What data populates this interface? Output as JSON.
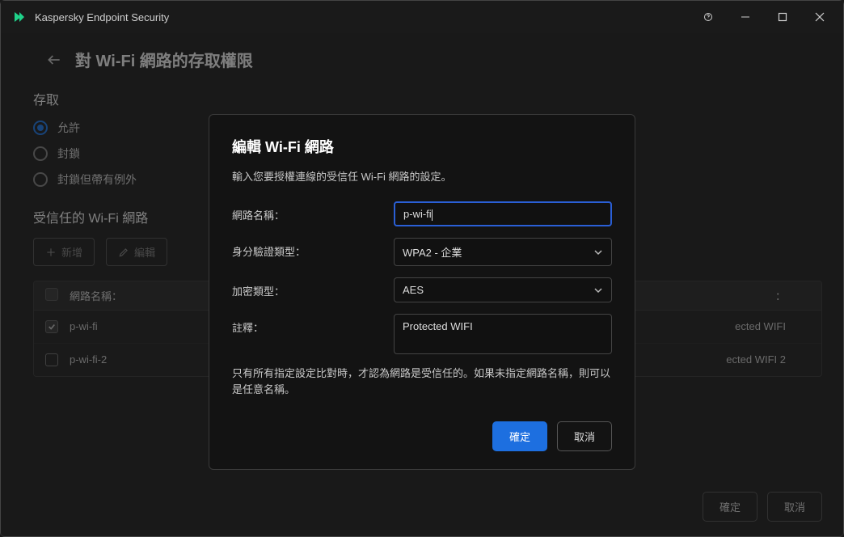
{
  "titlebar": {
    "app_title": "Kaspersky Endpoint Security"
  },
  "page": {
    "title": "對 Wi-Fi 網路的存取權限"
  },
  "access": {
    "section_label": "存取",
    "options": {
      "allow": "允許",
      "block": "封鎖",
      "block_with_exceptions": "封鎖但帶有例外"
    },
    "selected": "allow"
  },
  "trusted": {
    "label": "受信任的 Wi-Fi 網路",
    "add_label": "新增",
    "edit_label": "編輯",
    "table": {
      "col_name": "網路名稱：",
      "col_comment_suffix": "：",
      "rows": [
        {
          "checked": true,
          "name": "p-wi-fi",
          "comment_visible_suffix": "ected WIFI"
        },
        {
          "checked": false,
          "name": "p-wi-fi-2",
          "comment_visible_suffix": "ected WIFI 2"
        }
      ]
    }
  },
  "footer": {
    "ok": "確定",
    "cancel": "取消"
  },
  "modal": {
    "title": "編輯 Wi-Fi 網路",
    "subtitle": "輸入您要授權連線的受信任 Wi-Fi 網路的設定。",
    "labels": {
      "network_name": "網路名稱：",
      "auth_type": "身分驗證類型：",
      "enc_type": "加密類型：",
      "comment": "註釋："
    },
    "values": {
      "network_name": "p-wi-fi",
      "auth_type": "WPA2 - 企業",
      "enc_type": "AES",
      "comment": "Protected WIFI"
    },
    "note": "只有所有指定設定比對時，才認為網路是受信任的。如果未指定網路名稱，則可以是任意名稱。",
    "ok": "確定",
    "cancel": "取消"
  }
}
